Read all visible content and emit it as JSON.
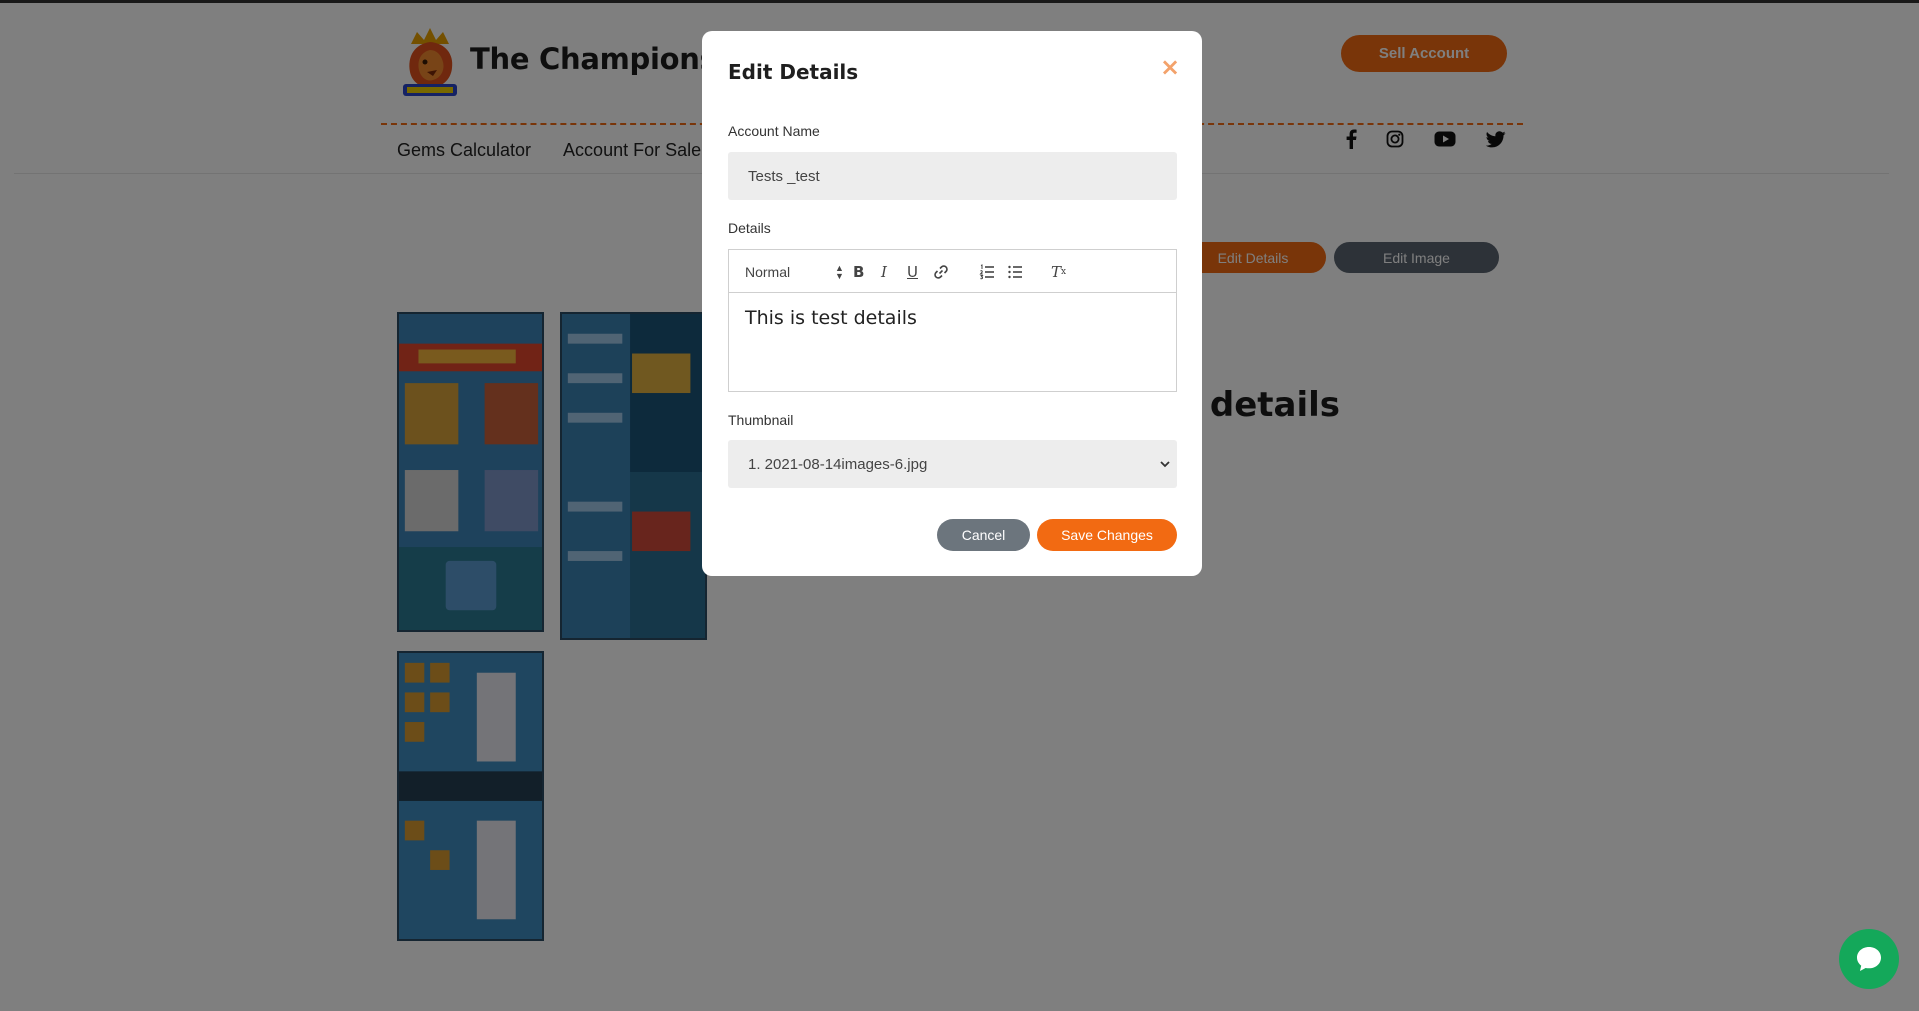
{
  "header": {
    "site_title": "The Champions Sh",
    "sell_button": "Sell Account",
    "nav": [
      "Gems Calculator",
      "Account For Sale"
    ],
    "social_icons": [
      "facebook-icon",
      "instagram-icon",
      "youtube-icon",
      "twitter-icon"
    ]
  },
  "page": {
    "edit_details_button": "Edit Details",
    "edit_image_button": "Edit Image",
    "details_text": "st details"
  },
  "modal": {
    "title": "Edit Details",
    "close_symbol": "×",
    "account_name_label": "Account Name",
    "account_name_value": "Tests _test",
    "details_label": "Details",
    "toolbar": {
      "format": "Normal",
      "bold": "B",
      "italic": "I",
      "underline": "U",
      "clean": "T"
    },
    "details_content": "This is test details",
    "thumbnail_label": "Thumbnail",
    "thumbnail_value": "1. 2021-08-14images-6.jpg",
    "cancel_button": "Cancel",
    "save_button": "Save Changes"
  },
  "colors": {
    "accent": "#f26a12",
    "secondary": "#5a6470",
    "chat": "#14a85a"
  }
}
